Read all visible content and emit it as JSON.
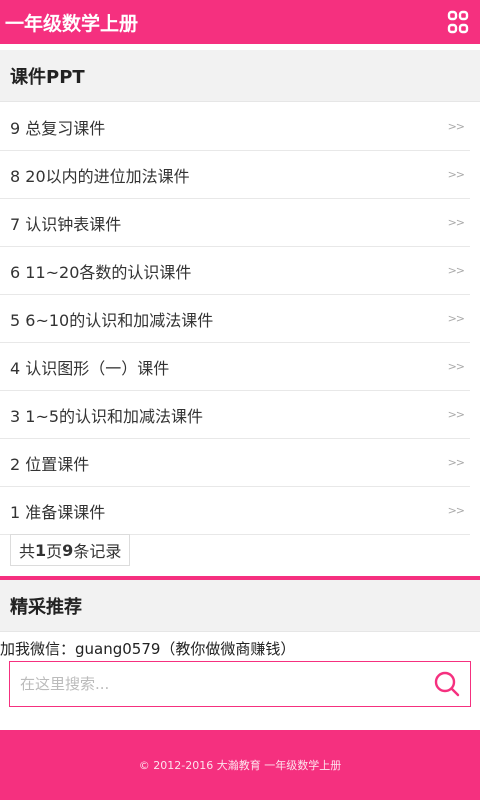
{
  "header": {
    "title": "一年级数学上册"
  },
  "courseware": {
    "heading": "课件PPT",
    "arrow": ">>",
    "items": [
      {
        "label": "9 总复习课件"
      },
      {
        "label": "8 20以内的进位加法课件"
      },
      {
        "label": "7 认识钟表课件"
      },
      {
        "label": "6 11~20各数的认识课件"
      },
      {
        "label": "5 6~10的认识和加减法课件"
      },
      {
        "label": "4 认识图形（一）课件"
      },
      {
        "label": "3 1~5的认识和加减法课件"
      },
      {
        "label": "2 位置课件"
      },
      {
        "label": "1 准备课课件"
      }
    ],
    "pager": {
      "prefix": "共 ",
      "pages": "1",
      "mid": "页",
      "count": "9",
      "suffix": "条记录"
    }
  },
  "featured": {
    "heading": "精采推荐"
  },
  "promo": {
    "text": "加我微信：guang0579（教你做微商赚钱）"
  },
  "search": {
    "placeholder": "在这里搜索..."
  },
  "footer": {
    "text": "© 2012-2016 大瀚教育  一年级数学上册"
  },
  "colors": {
    "accent": "#f5307f"
  },
  "icons": {
    "menu": "grid-menu-icon",
    "search": "search-icon"
  }
}
